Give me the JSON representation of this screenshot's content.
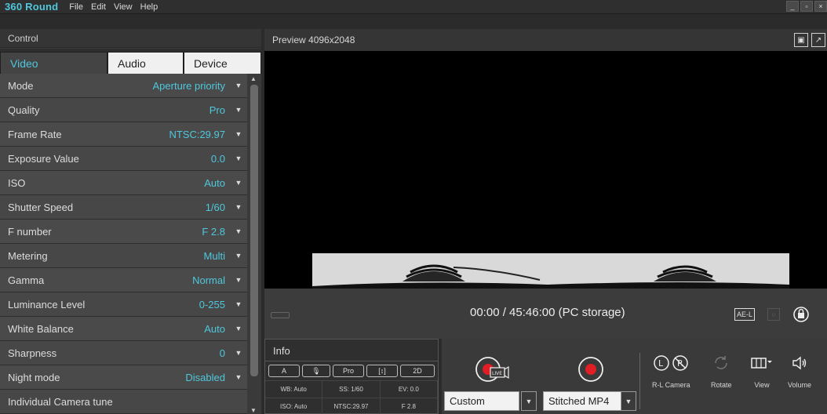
{
  "app": {
    "title": "360 Round",
    "menu": [
      "File",
      "Edit",
      "View",
      "Help"
    ],
    "window_controls": [
      "_",
      "▫",
      "×"
    ]
  },
  "control": {
    "header": "Control",
    "tabs": [
      "Video",
      "Audio",
      "Device"
    ],
    "active_tab": "Video",
    "params": [
      {
        "label": "Mode",
        "value": "Aperture priority"
      },
      {
        "label": "Quality",
        "value": "Pro"
      },
      {
        "label": "Frame Rate",
        "value": "NTSC:29.97"
      },
      {
        "label": "Exposure Value",
        "value": "0.0"
      },
      {
        "label": "ISO",
        "value": "Auto"
      },
      {
        "label": "Shutter Speed",
        "value": "1/60"
      },
      {
        "label": "F number",
        "value": "F 2.8"
      },
      {
        "label": "Metering",
        "value": "Multi"
      },
      {
        "label": "Gamma",
        "value": "Normal"
      },
      {
        "label": "Luminance Level",
        "value": "0-255"
      },
      {
        "label": "White Balance",
        "value": "Auto"
      },
      {
        "label": "Sharpness",
        "value": "0"
      },
      {
        "label": "Night mode",
        "value": "Disabled"
      },
      {
        "label": "Individual Camera tune",
        "value": ""
      }
    ]
  },
  "preview": {
    "title": "Preview 4096x2048"
  },
  "timeline": {
    "time": "00:00 / 45:46:00 (PC storage)",
    "ae_lock": "AE-L"
  },
  "info": {
    "title": "Info",
    "chips": [
      "A",
      "🎙",
      "Pro",
      "[↕]",
      "2D"
    ],
    "cells": [
      "WB: Auto",
      "SS: 1/60",
      "EV: 0.0",
      "ISO: Auto",
      "NTSC:29.97",
      "F 2.8"
    ]
  },
  "record": {
    "stream_select": "Custom",
    "format_select": "Stitched MP4",
    "tools": [
      {
        "label": "R-L Camera",
        "icon": "rl-camera-icon"
      },
      {
        "label": "Rotate",
        "icon": "rotate-icon"
      },
      {
        "label": "View",
        "icon": "view-icon"
      },
      {
        "label": "Volume",
        "icon": "volume-icon"
      }
    ]
  },
  "colors": {
    "accent": "#4fc7dc",
    "record_red": "#e01e25"
  }
}
